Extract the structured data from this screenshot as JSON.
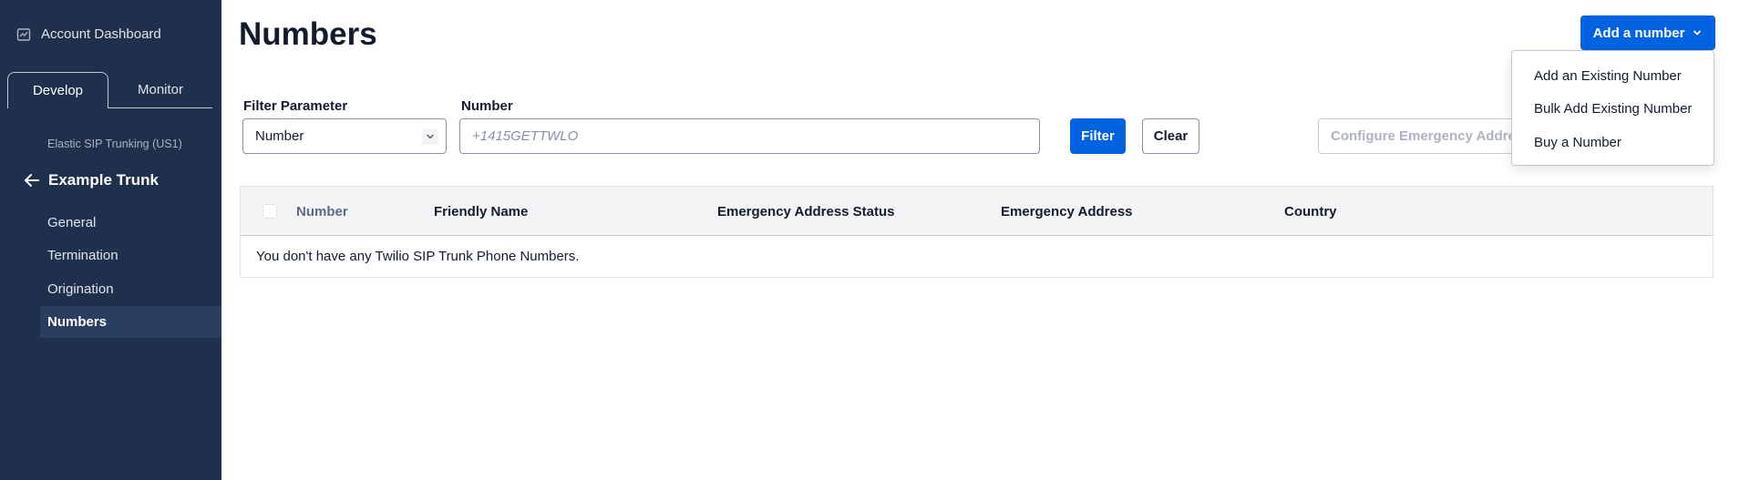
{
  "sidebar": {
    "account_dashboard": "Account Dashboard",
    "tabs": [
      {
        "label": "Develop",
        "active": true
      },
      {
        "label": "Monitor",
        "active": false
      }
    ],
    "service_label": "Elastic SIP Trunking (US1)",
    "trunk_name": "Example Trunk",
    "nav_items": [
      {
        "label": "General"
      },
      {
        "label": "Termination"
      },
      {
        "label": "Origination"
      },
      {
        "label": "Numbers"
      }
    ],
    "active_nav": "Numbers"
  },
  "page": {
    "title": "Numbers",
    "add_button_label": "Add a number"
  },
  "filters": {
    "parameter_label": "Filter Parameter",
    "parameter_value": "Number",
    "number_label": "Number",
    "number_placeholder": "+1415GETTWLO",
    "filter_button": "Filter",
    "clear_button": "Clear",
    "configure_button": "Configure Emergency Address"
  },
  "table": {
    "columns": [
      "Number",
      "Friendly Name",
      "Emergency Address Status",
      "Emergency Address",
      "Country"
    ],
    "empty_message": "You don't have any Twilio SIP Trunk Phone Numbers."
  },
  "dropdown": {
    "items": [
      "Add an Existing Number",
      "Bulk Add Existing Number",
      "Buy a Number"
    ]
  },
  "colors": {
    "sidebar_bg": "#1f304c",
    "primary": "#0263e0",
    "text": "#121c2d",
    "destructive": "#d61f1f"
  }
}
